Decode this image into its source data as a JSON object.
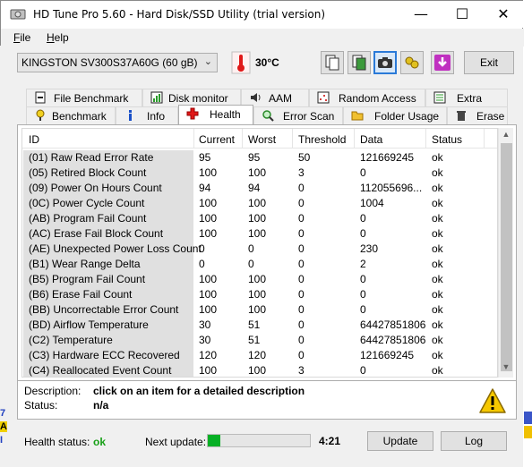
{
  "window": {
    "title": "HD Tune Pro 5.60 - Hard Disk/SSD Utility (trial version)"
  },
  "menu": [
    {
      "label": "File",
      "key": "F",
      "rest": "ile"
    },
    {
      "label": "Help",
      "key": "H",
      "rest": "elp"
    }
  ],
  "toolbar": {
    "drive": "KINGSTON SV300S37A60G (60 gB)",
    "temperature": "30°C",
    "exit_label": "Exit"
  },
  "tabs_top": [
    "File Benchmark",
    "Disk monitor",
    "AAM",
    "Random Access",
    "Extra tests"
  ],
  "tabs_bottom": [
    "Benchmark",
    "Info",
    "Health",
    "Error Scan",
    "Folder Usage",
    "Erase"
  ],
  "selected_tab": "Health",
  "table": {
    "columns": [
      "ID",
      "Current",
      "Worst",
      "Threshold",
      "Data",
      "Status"
    ],
    "rows": [
      [
        "(01) Raw Read Error Rate",
        "95",
        "95",
        "50",
        "121669245",
        "ok"
      ],
      [
        "(05) Retired Block Count",
        "100",
        "100",
        "3",
        "0",
        "ok"
      ],
      [
        "(09) Power On Hours Count",
        "94",
        "94",
        "0",
        "112055696...",
        "ok"
      ],
      [
        "(0C) Power Cycle Count",
        "100",
        "100",
        "0",
        "1004",
        "ok"
      ],
      [
        "(AB) Program Fail Count",
        "100",
        "100",
        "0",
        "0",
        "ok"
      ],
      [
        "(AC) Erase Fail Block Count",
        "100",
        "100",
        "0",
        "0",
        "ok"
      ],
      [
        "(AE) Unexpected Power Loss Count",
        "0",
        "0",
        "0",
        "230",
        "ok"
      ],
      [
        "(B1) Wear Range Delta",
        "0",
        "0",
        "0",
        "2",
        "ok"
      ],
      [
        "(B5) Program Fail Count",
        "100",
        "100",
        "0",
        "0",
        "ok"
      ],
      [
        "(B6) Erase Fail Count",
        "100",
        "100",
        "0",
        "0",
        "ok"
      ],
      [
        "(BB) Uncorrectable Error Count",
        "100",
        "100",
        "0",
        "0",
        "ok"
      ],
      [
        "(BD) Airflow Temperature",
        "30",
        "51",
        "0",
        "64427851806",
        "ok"
      ],
      [
        "(C2) Temperature",
        "30",
        "51",
        "0",
        "64427851806",
        "ok"
      ],
      [
        "(C3) Hardware ECC Recovered",
        "120",
        "120",
        "0",
        "121669245",
        "ok"
      ],
      [
        "(C4) Reallocated Event Count",
        "100",
        "100",
        "3",
        "0",
        "ok"
      ]
    ]
  },
  "description": {
    "desc_label": "Description:",
    "desc_value": "click on an item for a detailed description",
    "status_label": "Status:",
    "status_value": "n/a"
  },
  "footer": {
    "health_label": "Health status:",
    "health_value": "ok",
    "next_update_label": "Next update:",
    "progress": 0.12,
    "timer": "4:21",
    "update_label": "Update",
    "log_label": "Log"
  },
  "colors": {
    "health_ok": "#18a018",
    "progress_fill": "#06b025",
    "selected_toolbar": "#2a7ad8"
  }
}
